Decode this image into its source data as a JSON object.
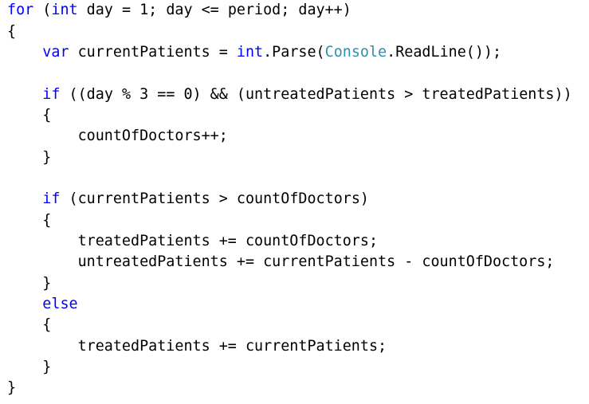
{
  "editor": {
    "colors": {
      "keyword": "#0000ff",
      "type": "#2b91af",
      "plain": "#000000",
      "background": "#ffffff"
    },
    "lines": [
      [
        {
          "t": "kw",
          "v": "for"
        },
        {
          "t": "pl",
          "v": " ("
        },
        {
          "t": "kw",
          "v": "int"
        },
        {
          "t": "pl",
          "v": " day = 1; day <= period; day++)"
        }
      ],
      [
        {
          "t": "pl",
          "v": "{"
        }
      ],
      [
        {
          "t": "pl",
          "v": "    "
        },
        {
          "t": "kw",
          "v": "var"
        },
        {
          "t": "pl",
          "v": " currentPatients = "
        },
        {
          "t": "kw",
          "v": "int"
        },
        {
          "t": "pl",
          "v": ".Parse("
        },
        {
          "t": "ty",
          "v": "Console"
        },
        {
          "t": "pl",
          "v": ".ReadLine());"
        }
      ],
      [],
      [
        {
          "t": "pl",
          "v": "    "
        },
        {
          "t": "kw",
          "v": "if"
        },
        {
          "t": "pl",
          "v": " ((day % 3 == 0) && (untreatedPatients > treatedPatients))"
        }
      ],
      [
        {
          "t": "pl",
          "v": "    {"
        }
      ],
      [
        {
          "t": "pl",
          "v": "        countOfDoctors++;"
        }
      ],
      [
        {
          "t": "pl",
          "v": "    }"
        }
      ],
      [],
      [
        {
          "t": "pl",
          "v": "    "
        },
        {
          "t": "kw",
          "v": "if"
        },
        {
          "t": "pl",
          "v": " (currentPatients > countOfDoctors)"
        }
      ],
      [
        {
          "t": "pl",
          "v": "    {"
        }
      ],
      [
        {
          "t": "pl",
          "v": "        treatedPatients += countOfDoctors;"
        }
      ],
      [
        {
          "t": "pl",
          "v": "        untreatedPatients += currentPatients - countOfDoctors;"
        }
      ],
      [
        {
          "t": "pl",
          "v": "    }"
        }
      ],
      [
        {
          "t": "pl",
          "v": "    "
        },
        {
          "t": "kw",
          "v": "else"
        }
      ],
      [
        {
          "t": "pl",
          "v": "    {"
        }
      ],
      [
        {
          "t": "pl",
          "v": "        treatedPatients += currentPatients;"
        }
      ],
      [
        {
          "t": "pl",
          "v": "    }"
        }
      ],
      [
        {
          "t": "pl",
          "v": "}"
        }
      ]
    ]
  }
}
